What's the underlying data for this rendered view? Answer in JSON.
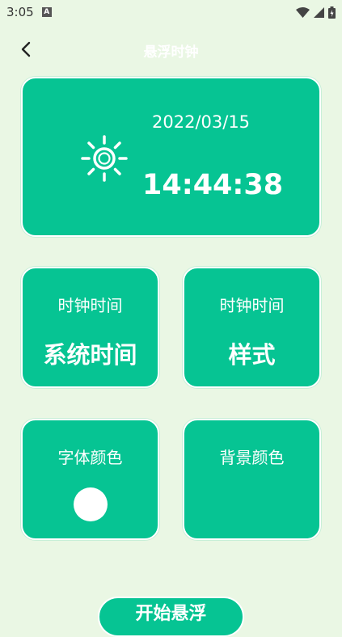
{
  "status_bar": {
    "time": "3:05",
    "notification_letter": "A"
  },
  "header": {
    "title": "悬浮时钟"
  },
  "clock": {
    "date": "2022/03/15",
    "time": "14:44:38"
  },
  "settings": {
    "time_source": {
      "label": "时钟时间",
      "value": "系统时间"
    },
    "style": {
      "label": "时钟时间",
      "value": "样式"
    },
    "font_color": {
      "label": "字体颜色",
      "color": "#ffffff"
    },
    "background_color": {
      "label": "背景颜色"
    }
  },
  "actions": {
    "start_label": "开始悬浮"
  },
  "theme": {
    "accent": "#06c493",
    "background": "#eaf7e4"
  }
}
